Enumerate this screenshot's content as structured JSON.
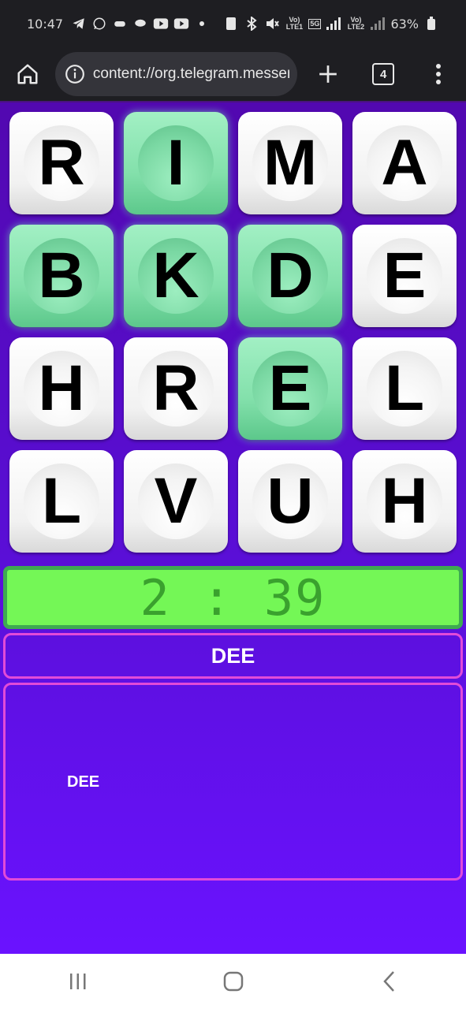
{
  "status": {
    "time": "10:47",
    "battery": "63%",
    "net1": "Vo) LTE1",
    "net2": "Vo) LTE2",
    "net_5g": "5G",
    "app_icons": [
      "telegram-icon",
      "whatsapp-icon",
      "game-controller-icon",
      "chat-icon",
      "youtube-icon",
      "youtube-icon"
    ],
    "system_icons": [
      "bluetooth-icon",
      "mute-icon"
    ]
  },
  "browser": {
    "url": "content://org.telegram.messer",
    "tab_count": "4"
  },
  "board": {
    "tiles": [
      {
        "letter": "R",
        "selected": false
      },
      {
        "letter": "I",
        "selected": true
      },
      {
        "letter": "M",
        "selected": false
      },
      {
        "letter": "A",
        "selected": false
      },
      {
        "letter": "B",
        "selected": true
      },
      {
        "letter": "K",
        "selected": true
      },
      {
        "letter": "D",
        "selected": true
      },
      {
        "letter": "E",
        "selected": false
      },
      {
        "letter": "H",
        "selected": false
      },
      {
        "letter": "R",
        "selected": false
      },
      {
        "letter": "E",
        "selected": true
      },
      {
        "letter": "L",
        "selected": false
      },
      {
        "letter": "L",
        "selected": false
      },
      {
        "letter": "V",
        "selected": false
      },
      {
        "letter": "U",
        "selected": false
      },
      {
        "letter": "H",
        "selected": false
      }
    ]
  },
  "timer": {
    "text": "2 : 39"
  },
  "current_word": "DEE",
  "found_words": [
    "DEE"
  ],
  "colors": {
    "background": "#5a0fd8",
    "tile_selected": "#83e0ab",
    "tile": "#f4f4f4",
    "timer_bg": "#74f756",
    "timer_text": "#3aa12e",
    "box_border": "#e24bd8"
  }
}
